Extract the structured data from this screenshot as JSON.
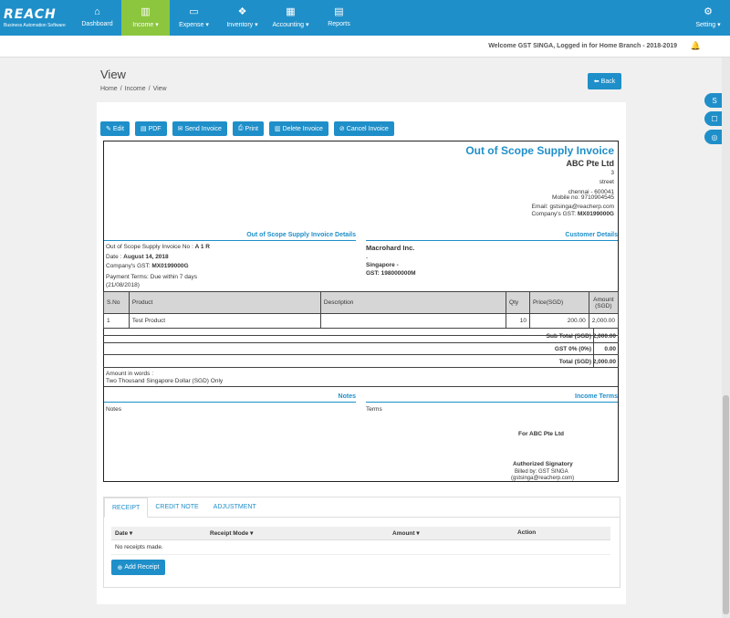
{
  "brand": {
    "name": "REACH",
    "tagline": "Business Automation Software"
  },
  "nav": [
    {
      "label": "Dashboard",
      "icon": "⌂",
      "name": "dashboard"
    },
    {
      "label": "Income",
      "icon": "▥",
      "name": "income",
      "active": true
    },
    {
      "label": "Expense",
      "icon": "▭",
      "name": "expense"
    },
    {
      "label": "Inventory",
      "icon": "❖",
      "name": "inventory"
    },
    {
      "label": "Accounting",
      "icon": "▦",
      "name": "accounting"
    },
    {
      "label": "Reports",
      "icon": "▤",
      "name": "reports"
    }
  ],
  "setting": {
    "label": "Setting",
    "icon": "⚙"
  },
  "welcome": "Welcome GST SINGA, Logged in for Home Branch - 2018-2019",
  "page": {
    "title": "View",
    "breadcrumb": [
      "Home",
      "/",
      "Income",
      "/",
      "View"
    ],
    "back": "Back"
  },
  "toolbar": {
    "edit": "Edit",
    "pdf": "PDF",
    "send": "Send Invoice",
    "print": "Print",
    "delete": "Delete Invoice",
    "cancel": "Cancel Invoice"
  },
  "invoice": {
    "title": "Out of Scope Supply Invoice",
    "company": "ABC Pte Ltd",
    "address": [
      "3",
      "street",
      "chennai - 600041",
      "Mobile no: 9710904545",
      "Email: gstsinga@reacherp.com"
    ],
    "company_gst_label": "Company's GST:",
    "company_gst": "MX0199000G",
    "details_heading": "Out of Scope Supply Invoice Details",
    "customer_heading": "Customer Details",
    "invoice_no_label": "Out of Scope Supply Invoice No :",
    "invoice_no": "A 1 R",
    "date_label": "Date :",
    "date": "August 14, 2018",
    "gst_label": "Company's GST:",
    "gst": "MX0199000G",
    "payment_terms": "Payment Terms: Due within 7 days",
    "payment_date": "(21/08/2018)",
    "customer_name": "Macrohard Inc.",
    "customer_line": "-",
    "customer_country": "Singapore -",
    "customer_gst": "GST: 198000000M",
    "columns": [
      "S.No",
      "Product",
      "Description",
      "Qty",
      "Price(SGD)",
      "Amount (SGD)"
    ],
    "rows": [
      {
        "sno": "1",
        "product": "Test Product",
        "description": "",
        "qty": "10",
        "price": "200.00",
        "amount": "2,000.00"
      }
    ],
    "subtotal_label": "Sub Total (SGD)",
    "subtotal": "2,000.00",
    "gst_tax_label": "GST 0% (0%)",
    "gst_tax": "0.00",
    "total_label": "Total (SGD)",
    "total": "2,000.00",
    "words_label": "Amount in words :",
    "words": "Two Thousand Singapore Dollar (SGD) Only",
    "notes_heading": "Notes",
    "notes_label": "Notes",
    "terms_heading": "Income Terms",
    "terms_label": "Terms",
    "for_company": "For ABC Pte Ltd",
    "signatory": "Authorized Signatory",
    "billed_by": "Billed by: GST SINGA",
    "billed_email": "(gstsinga@reacherp.com)"
  },
  "tabs": [
    "RECEIPT",
    "CREDIT NOTE",
    "ADJUSTMENT"
  ],
  "receipts": {
    "columns": [
      "Date",
      "Receipt Mode",
      "Amount",
      "Action"
    ],
    "empty": "No receipts made.",
    "add": "Add Receipt"
  }
}
